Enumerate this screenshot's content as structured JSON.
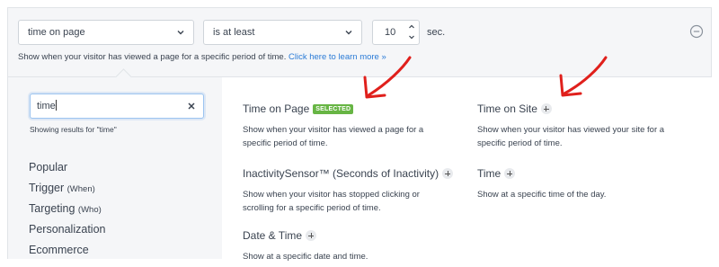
{
  "rule": {
    "condition_select": "time on page",
    "operator_select": "is at least",
    "value": "10",
    "unit": "sec.",
    "helper_text": "Show when your visitor has viewed a page for a specific period of time.",
    "helper_link": "Click here to learn more »"
  },
  "search": {
    "value": "time",
    "results_note": "Showing results for \"time\""
  },
  "sidebar": {
    "items": [
      {
        "label": "Popular",
        "sub": ""
      },
      {
        "label": "Trigger",
        "sub": "(When)"
      },
      {
        "label": "Targeting",
        "sub": "(Who)"
      },
      {
        "label": "Personalization",
        "sub": ""
      },
      {
        "label": "Ecommerce",
        "sub": ""
      }
    ]
  },
  "options": [
    {
      "title": "Time on Page",
      "badge": "SELECTED",
      "desc": "Show when your visitor has viewed a page for a specific period of time."
    },
    {
      "title": "Time on Site",
      "desc": "Show when your visitor has viewed your site for a specific period of time."
    },
    {
      "title": "InactivitySensor™ (Seconds of Inactivity)",
      "desc": "Show when your visitor has stopped clicking or scrolling for a specific period of time."
    },
    {
      "title": "Time",
      "desc": "Show at a specific time of the day."
    },
    {
      "title": "Date & Time",
      "desc": "Show at a specific date and time."
    }
  ],
  "icons": {
    "select_chevron": "chevron-down-icon",
    "stepper_up": "chevron-up-icon",
    "stepper_down": "chevron-down-icon",
    "remove": "minus-circle-icon",
    "clear": "close-icon",
    "add": "plus-icon",
    "annotation": "red-arrow-icon"
  },
  "colors": {
    "accent_link": "#2b7bd6",
    "selected_badge": "#67b544",
    "annotation_arrow": "#e0201c",
    "panel_bg": "#f5f6f8"
  }
}
